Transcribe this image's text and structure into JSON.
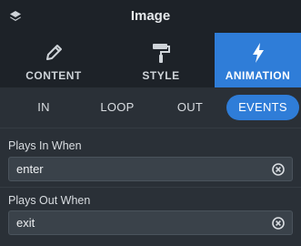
{
  "header": {
    "title": "Image"
  },
  "tabs": [
    {
      "label": "CONTENT",
      "icon": "pencil-icon"
    },
    {
      "label": "STYLE",
      "icon": "paint-roller-icon"
    },
    {
      "label": "ANIMATION",
      "icon": "lightning-icon"
    }
  ],
  "subtabs": [
    "IN",
    "LOOP",
    "OUT",
    "EVENTS"
  ],
  "fields": [
    {
      "label": "Plays In When",
      "value": "enter"
    },
    {
      "label": "Plays Out When",
      "value": "exit"
    }
  ],
  "colors": {
    "accent": "#2f7dd8",
    "header_bg": "#1d2228",
    "panel_bg": "#2a3037"
  }
}
